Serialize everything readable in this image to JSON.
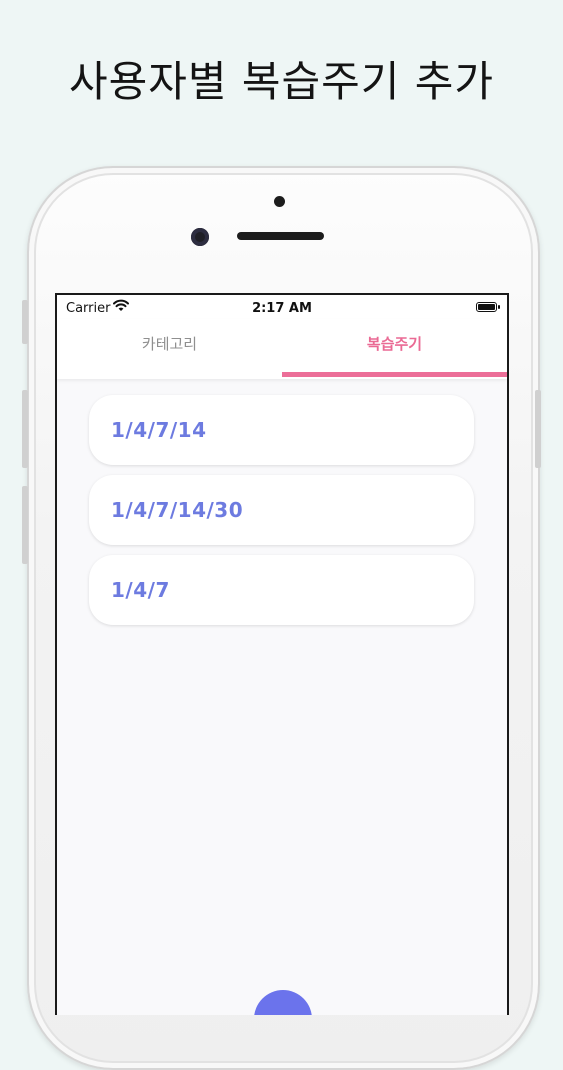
{
  "headline": "사용자별 복습주기 추가",
  "status_bar": {
    "carrier": "Carrier",
    "time": "2:17 AM",
    "wifi_icon": "wifi-icon",
    "battery_icon": "battery-icon"
  },
  "tabs": [
    {
      "label": "카테고리",
      "active": false
    },
    {
      "label": "복습주기",
      "active": true
    }
  ],
  "cycles": [
    {
      "label": "1/4/7/14"
    },
    {
      "label": "1/4/7/14/30"
    },
    {
      "label": "1/4/7"
    }
  ],
  "colors": {
    "accent_pink": "#ec6e98",
    "card_text": "#6d7be0",
    "fab": "#6b73ec",
    "background": "#eef6f5"
  },
  "fab": {
    "icon": "add-button"
  }
}
